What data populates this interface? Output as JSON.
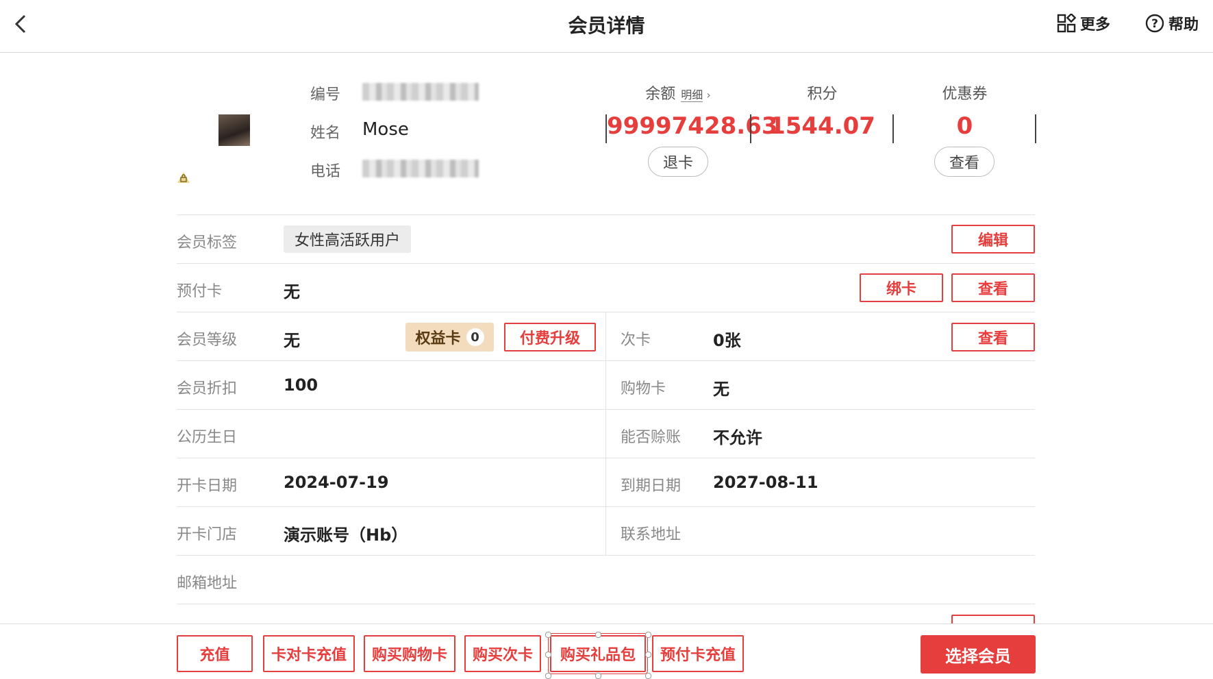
{
  "header": {
    "title": "会员详情",
    "more_label": "更多",
    "help_label": "帮助"
  },
  "profile": {
    "id_label": "编号",
    "name_label": "姓名",
    "name_value": "Mose",
    "phone_label": "电话"
  },
  "stats": {
    "balance_label": "余额",
    "balance_detail_label": "明细",
    "balance_value": "99997428.63",
    "refund_label": "退卡",
    "points_label": "积分",
    "points_value": "1544.07",
    "coupon_label": "优惠券",
    "coupon_value": "0",
    "view_label": "查看"
  },
  "rows": {
    "tag_label": "会员标签",
    "tag_value": "女性高活跃用户",
    "edit_button": "编辑",
    "prepaid_label": "预付卡",
    "prepaid_value": "无",
    "bind_button": "绑卡",
    "prepaid_view_button": "查看",
    "level_label": "会员等级",
    "level_value": "无",
    "rights_label": "权益卡",
    "rights_count": "0",
    "upgrade_button": "付费升级",
    "times_label": "次卡",
    "times_value": "0张",
    "times_view_button": "查看",
    "discount_label": "会员折扣",
    "discount_value": "100",
    "shopping_label": "购物卡",
    "shopping_value": "无",
    "birthday_label": "公历生日",
    "birthday_value": "",
    "credit_label": "能否赊账",
    "credit_value": "不允许",
    "open_date_label": "开卡日期",
    "open_date_value": "2024-07-19",
    "expire_label": "到期日期",
    "expire_value": "2027-08-11",
    "store_label": "开卡门店",
    "store_value": "演示账号（Hb）",
    "address_label": "联系地址",
    "address_value": "",
    "email_label": "邮箱地址",
    "email_value": ""
  },
  "bottom": {
    "recharge": "充值",
    "card_to_card": "卡对卡充值",
    "buy_shopping_card": "购买购物卡",
    "buy_times_card": "购买次卡",
    "buy_gift_pack": "购买礼品包",
    "prepaid_recharge": "预付卡充值",
    "select_member": "选择会员"
  },
  "colors": {
    "accent": "#e63d3d",
    "rights_bg": "#f3dcbd"
  }
}
